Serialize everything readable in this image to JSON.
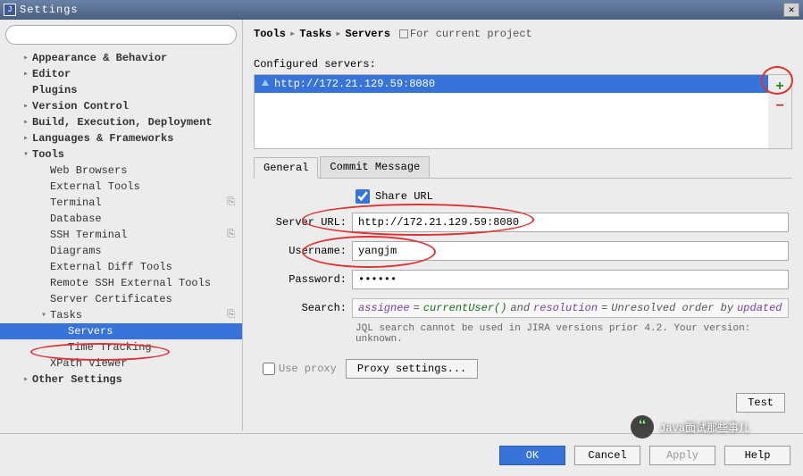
{
  "window": {
    "title": "Settings"
  },
  "search_placeholder": "",
  "sidebar": {
    "items": [
      {
        "label": "Appearance & Behavior",
        "level": 1,
        "arrow": "▸",
        "bold": true
      },
      {
        "label": "Editor",
        "level": 1,
        "arrow": "▸",
        "bold": true
      },
      {
        "label": "Plugins",
        "level": 1,
        "arrow": "",
        "bold": true
      },
      {
        "label": "Version Control",
        "level": 1,
        "arrow": "▸",
        "bold": true
      },
      {
        "label": "Build, Execution, Deployment",
        "level": 1,
        "arrow": "▸",
        "bold": true
      },
      {
        "label": "Languages & Frameworks",
        "level": 1,
        "arrow": "▸",
        "bold": true
      },
      {
        "label": "Tools",
        "level": 1,
        "arrow": "▾",
        "bold": true
      },
      {
        "label": "Web Browsers",
        "level": 2,
        "arrow": ""
      },
      {
        "label": "External Tools",
        "level": 2,
        "arrow": ""
      },
      {
        "label": "Terminal",
        "level": 2,
        "arrow": "",
        "cp": "☐"
      },
      {
        "label": "Database",
        "level": 2,
        "arrow": ""
      },
      {
        "label": "SSH Terminal",
        "level": 2,
        "arrow": "",
        "cp": "☐"
      },
      {
        "label": "Diagrams",
        "level": 2,
        "arrow": ""
      },
      {
        "label": "External Diff Tools",
        "level": 2,
        "arrow": ""
      },
      {
        "label": "Remote SSH External Tools",
        "level": 2,
        "arrow": ""
      },
      {
        "label": "Server Certificates",
        "level": 2,
        "arrow": ""
      },
      {
        "label": "Tasks",
        "level": 2,
        "arrow": "▾",
        "cp": "☐"
      },
      {
        "label": "Servers",
        "level": 3,
        "arrow": "",
        "sel": true
      },
      {
        "label": "Time Tracking",
        "level": 3,
        "arrow": ""
      },
      {
        "label": "XPath Viewer",
        "level": 2,
        "arrow": ""
      },
      {
        "label": "Other Settings",
        "level": 1,
        "arrow": "▸",
        "bold": true
      }
    ]
  },
  "breadcrumb": {
    "a": "Tools",
    "b": "Tasks",
    "c": "Servers",
    "fcp": "For current project"
  },
  "configured_label": "Configured servers:",
  "servers": [
    {
      "url": "http://172.21.129.59:8080"
    }
  ],
  "tabs": {
    "general": "General",
    "commit": "Commit Message"
  },
  "form": {
    "share_label": "Share URL",
    "server_url_label": "Server URL:",
    "server_url": "http://172.21.129.59:8080",
    "username_label": "Username:",
    "username": "yangjm",
    "password_label": "Password:",
    "password": "******",
    "search_label": "Search:",
    "search_expr": {
      "p1": "assignee",
      "eq": "=",
      "p2": "currentUser",
      "paren": "()",
      "and": "and",
      "p3": "resolution",
      "eq2": "=",
      "p4": "Unresolved order by",
      "p5": "updated"
    },
    "hint": "JQL search cannot be used in JIRA versions prior 4.2. Your version: unknown.",
    "use_proxy": "Use proxy",
    "proxy_btn": "Proxy settings...",
    "test_btn": "Test"
  },
  "buttons": {
    "ok": "OK",
    "cancel": "Cancel",
    "apply": "Apply",
    "help": "Help"
  },
  "watermark": "Java面试那些事儿"
}
